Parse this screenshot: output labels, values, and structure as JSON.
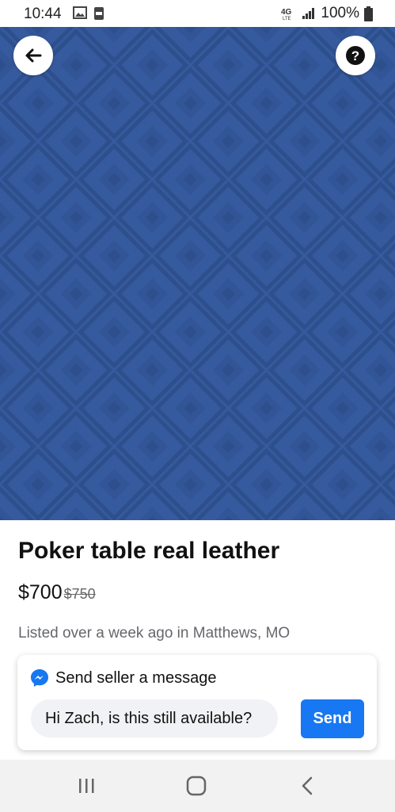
{
  "status_bar": {
    "time": "10:44",
    "network_label": "4G LTE",
    "battery_percent": "100%",
    "icons": [
      "image-icon",
      "notification-100-icon",
      "4g-lte-icon",
      "signal-bars-icon",
      "battery-icon"
    ]
  },
  "photo": {
    "colors": {
      "base": "#3a5fa3",
      "pattern": "#2f528f"
    },
    "page_count": 3,
    "active_page_index": 1
  },
  "listing": {
    "title": "Poker table real leather",
    "price": "$700",
    "old_price": "$750",
    "listed_text": "Listed over a week ago in Matthews, MO"
  },
  "message_box": {
    "heading": "Send seller a message",
    "input_value": "Hi Zach, is this still available?",
    "send_label": "Send",
    "accent_color": "#1877f2"
  },
  "nav_bar": {
    "icons": [
      "recent-apps-icon",
      "home-icon",
      "back-nav-icon"
    ]
  }
}
